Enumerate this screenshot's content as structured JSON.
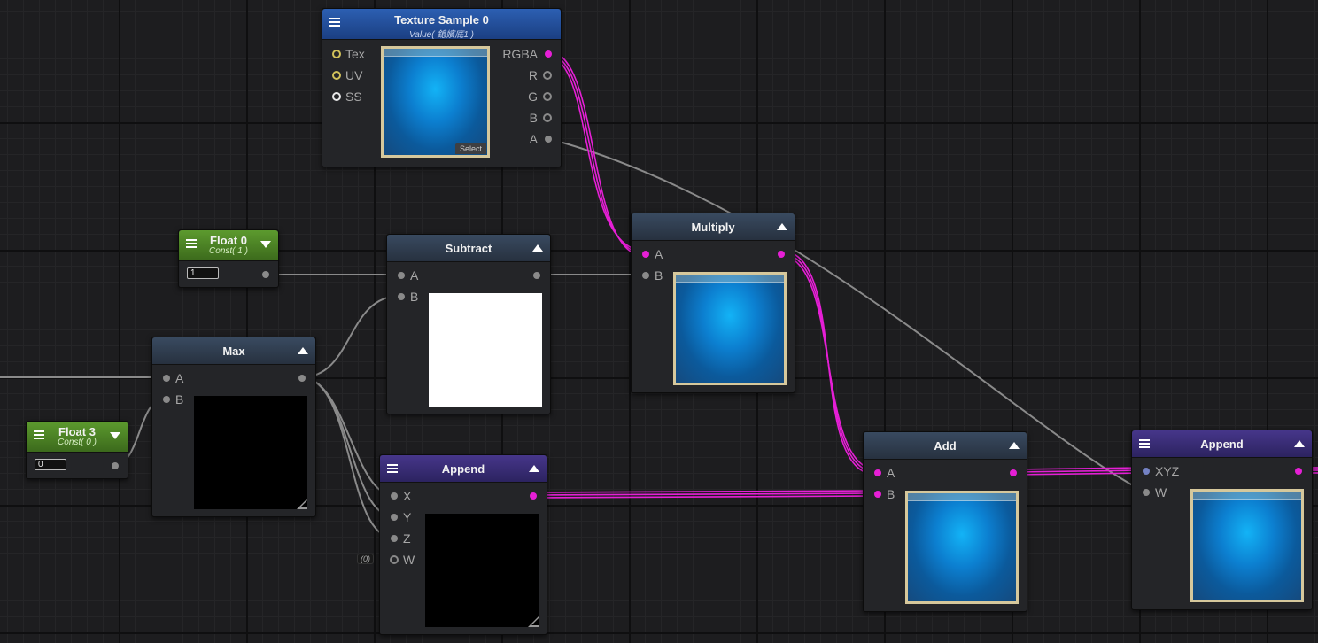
{
  "graph": {
    "colors": {
      "background": "#1d1d1f",
      "data_wire": "#e61fd6",
      "float_wire": "#8a8a8a"
    },
    "nodes": {
      "texture_sample": {
        "title": "Texture Sample 0",
        "subtitle": "Value( 鎴嬪底1 )",
        "inputs": [
          "Tex",
          "UV",
          "SS"
        ],
        "outputs": [
          "RGBA",
          "R",
          "G",
          "B",
          "A"
        ],
        "select_label": "Select",
        "preview": "blue-texture"
      },
      "float0": {
        "title": "Float 0",
        "subtitle": "Const( 1 )",
        "value": "1"
      },
      "float3": {
        "title": "Float 3",
        "subtitle": "Const( 0 )",
        "value": "0"
      },
      "subtract": {
        "title": "Subtract",
        "inputs": [
          "A",
          "B"
        ],
        "preview": "white"
      },
      "multiply": {
        "title": "Multiply",
        "inputs": [
          "A",
          "B"
        ],
        "preview": "blue-texture"
      },
      "max": {
        "title": "Max",
        "inputs": [
          "A",
          "B"
        ],
        "preview": "black"
      },
      "append1": {
        "title": "Append",
        "inputs": [
          "X",
          "Y",
          "Z",
          "W"
        ],
        "w_default": "(0)",
        "preview": "black"
      },
      "add": {
        "title": "Add",
        "inputs": [
          "A",
          "B"
        ],
        "preview": "blue-texture"
      },
      "append2": {
        "title": "Append",
        "inputs": [
          "XYZ",
          "W"
        ],
        "preview": "blue-texture"
      }
    }
  }
}
